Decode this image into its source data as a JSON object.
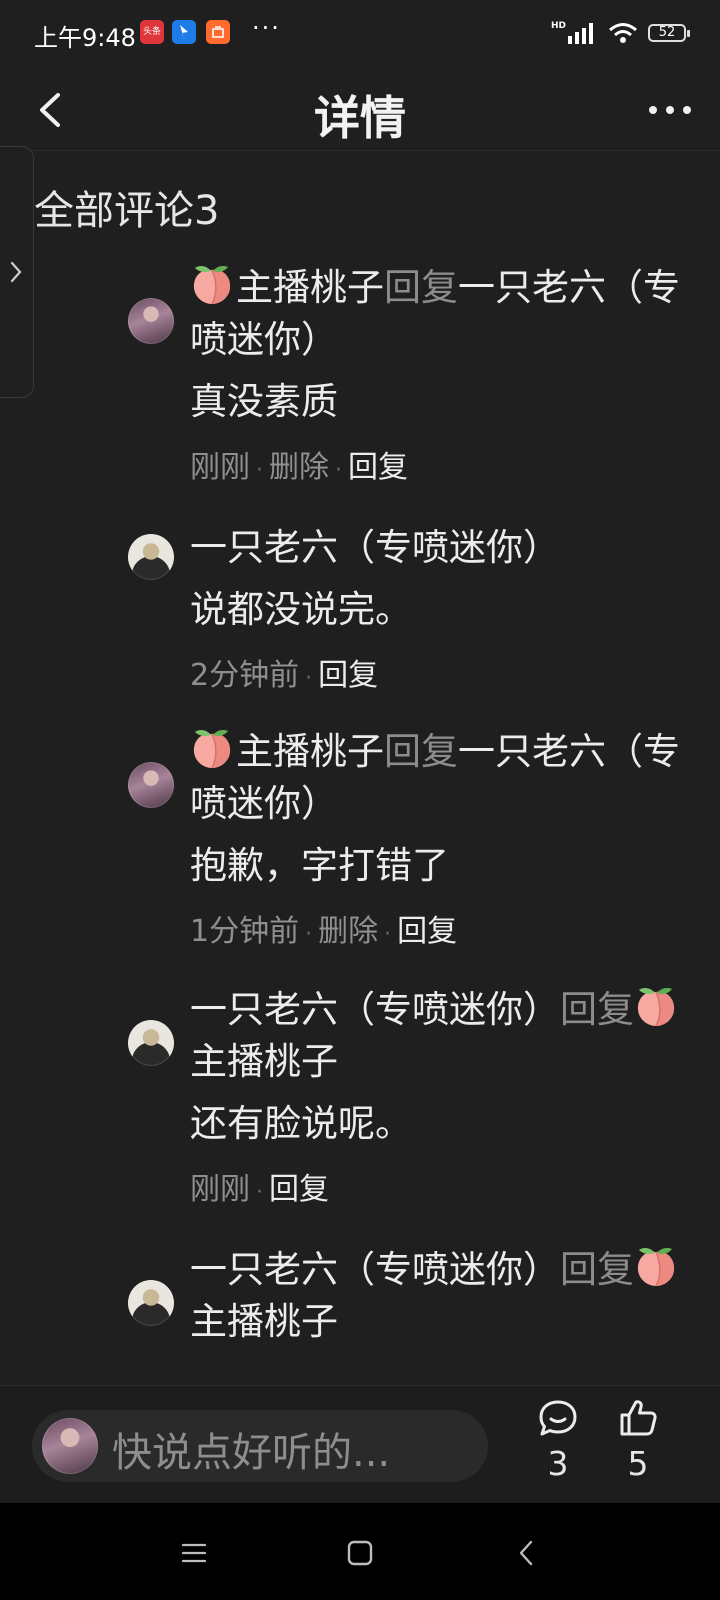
{
  "status_bar": {
    "time": "上午9:48",
    "app_icons": [
      {
        "name": "toutiao-icon",
        "label": "头条",
        "color": "#e0353a"
      },
      {
        "name": "map-pin-icon",
        "label": "",
        "color": "#1e7be8"
      },
      {
        "name": "mi-icon",
        "label": "",
        "color": "#ff6a2e"
      }
    ],
    "more_dots": "···",
    "network": "HD",
    "battery": "52"
  },
  "header": {
    "title": "详情"
  },
  "comments_section": {
    "title": "全部评论3",
    "comments": [
      {
        "avatar": "host",
        "author": "主播桃子",
        "author_has_peach": true,
        "reply_word": "回复",
        "reply_to": "一只老六（专喷迷你）",
        "reply_to_has_peach": false,
        "text": "真没素质",
        "time": "刚刚",
        "delete_label": "删除",
        "reply_label": "回复"
      },
      {
        "avatar": "guest",
        "author": "一只老六（专喷迷你）",
        "author_has_peach": false,
        "reply_word": "",
        "reply_to": "",
        "reply_to_has_peach": false,
        "text": "说都没说完。",
        "time": "2分钟前",
        "delete_label": "",
        "reply_label": "回复"
      },
      {
        "avatar": "host",
        "author": "主播桃子",
        "author_has_peach": true,
        "reply_word": "回复",
        "reply_to": "一只老六（专喷迷你）",
        "reply_to_has_peach": false,
        "text": "抱歉，字打错了",
        "time": "1分钟前",
        "delete_label": "删除",
        "reply_label": "回复"
      },
      {
        "avatar": "guest",
        "author": "一只老六（专喷迷你）",
        "author_has_peach": false,
        "reply_word": "回复",
        "reply_to": "主播桃子",
        "reply_to_has_peach": true,
        "text": "还有脸说呢。",
        "time": "刚刚",
        "delete_label": "",
        "reply_label": "回复"
      },
      {
        "avatar": "guest",
        "author": "一只老六（专喷迷你）",
        "author_has_peach": false,
        "reply_word": "回复",
        "reply_to": "主播桃子",
        "reply_to_has_peach": true,
        "text": "",
        "time": "",
        "delete_label": "",
        "reply_label": ""
      }
    ]
  },
  "bottom_bar": {
    "input_placeholder": "快说点好听的...",
    "comment_count": "3",
    "like_count": "5"
  },
  "colors": {
    "background": "#1f1f1f",
    "muted_text": "#8c8c8c",
    "primary_text": "#ececec"
  }
}
